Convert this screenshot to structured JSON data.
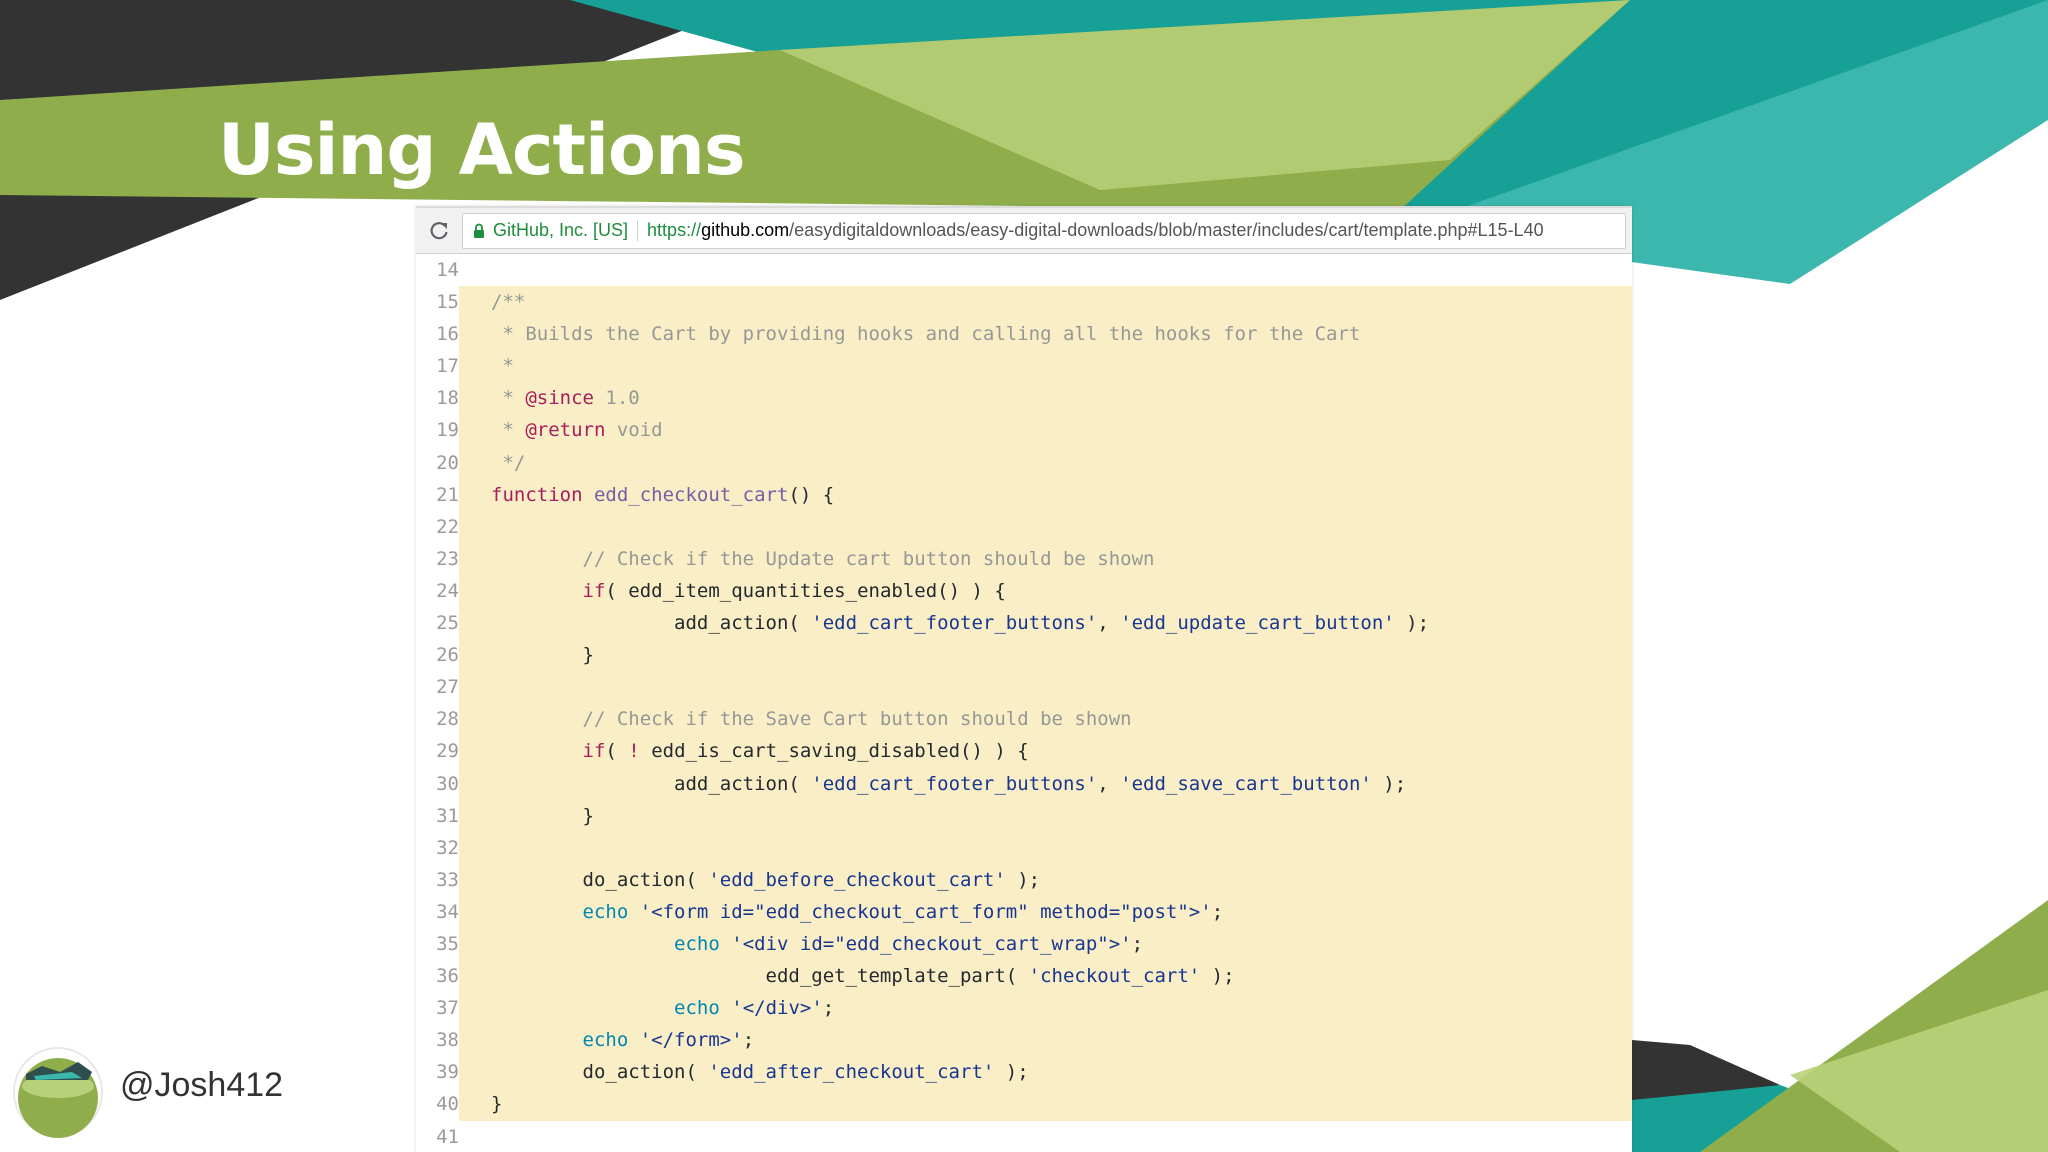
{
  "slide": {
    "title": "Using Actions",
    "handle": "@Josh412",
    "colors": {
      "dark": "#333333",
      "green": "#8fae4b",
      "light_green": "#b9d07a",
      "teal": "#17a096",
      "light_teal": "#3bb7ad"
    }
  },
  "browser": {
    "reload_icon": "reload-icon",
    "lock_icon": "lock-icon",
    "ev_label": "GitHub, Inc. [US]",
    "url_scheme": "https://",
    "url_host": "github.com",
    "url_path": "/easydigitaldownloads/easy-digital-downloads/blob/master/includes/cart/template.php#L15-L40"
  },
  "code": {
    "highlight_range": [
      15,
      40
    ],
    "lines": [
      {
        "n": "14",
        "tokens": []
      },
      {
        "n": "15",
        "tokens": [
          {
            "t": "comment",
            "v": "/**"
          }
        ]
      },
      {
        "n": "16",
        "tokens": [
          {
            "t": "comment",
            "v": " * Builds the Cart by providing hooks and calling all the hooks for the Cart"
          }
        ]
      },
      {
        "n": "17",
        "tokens": [
          {
            "t": "comment",
            "v": " *"
          }
        ]
      },
      {
        "n": "18",
        "tokens": [
          {
            "t": "comment",
            "v": " * "
          },
          {
            "t": "doctag",
            "v": "@since"
          },
          {
            "t": "comment",
            "v": " 1.0"
          }
        ]
      },
      {
        "n": "19",
        "tokens": [
          {
            "t": "comment",
            "v": " * "
          },
          {
            "t": "doctag",
            "v": "@return"
          },
          {
            "t": "comment",
            "v": " void"
          }
        ]
      },
      {
        "n": "20",
        "tokens": [
          {
            "t": "comment",
            "v": " */"
          }
        ]
      },
      {
        "n": "21",
        "tokens": [
          {
            "t": "kw",
            "v": "function"
          },
          {
            "t": "plain",
            "v": " "
          },
          {
            "t": "fn",
            "v": "edd_checkout_cart"
          },
          {
            "t": "plain",
            "v": "() {"
          }
        ]
      },
      {
        "n": "22",
        "tokens": []
      },
      {
        "n": "23",
        "tokens": [
          {
            "t": "plain",
            "v": "        "
          },
          {
            "t": "comment",
            "v": "// Check if the Update cart button should be shown"
          }
        ]
      },
      {
        "n": "24",
        "tokens": [
          {
            "t": "plain",
            "v": "        "
          },
          {
            "t": "kw",
            "v": "if"
          },
          {
            "t": "plain",
            "v": "( edd_item_quantities_enabled() ) {"
          }
        ]
      },
      {
        "n": "25",
        "tokens": [
          {
            "t": "plain",
            "v": "                add_action( "
          },
          {
            "t": "str",
            "v": "'edd_cart_footer_buttons'"
          },
          {
            "t": "plain",
            "v": ", "
          },
          {
            "t": "str",
            "v": "'edd_update_cart_button'"
          },
          {
            "t": "plain",
            "v": " );"
          }
        ]
      },
      {
        "n": "26",
        "tokens": [
          {
            "t": "plain",
            "v": "        }"
          }
        ]
      },
      {
        "n": "27",
        "tokens": []
      },
      {
        "n": "28",
        "tokens": [
          {
            "t": "plain",
            "v": "        "
          },
          {
            "t": "comment",
            "v": "// Check if the Save Cart button should be shown"
          }
        ]
      },
      {
        "n": "29",
        "tokens": [
          {
            "t": "plain",
            "v": "        "
          },
          {
            "t": "kw",
            "v": "if"
          },
          {
            "t": "plain",
            "v": "( "
          },
          {
            "t": "kw",
            "v": "!"
          },
          {
            "t": "plain",
            "v": " edd_is_cart_saving_disabled() ) {"
          }
        ]
      },
      {
        "n": "30",
        "tokens": [
          {
            "t": "plain",
            "v": "                add_action( "
          },
          {
            "t": "str",
            "v": "'edd_cart_footer_buttons'"
          },
          {
            "t": "plain",
            "v": ", "
          },
          {
            "t": "str",
            "v": "'edd_save_cart_button'"
          },
          {
            "t": "plain",
            "v": " );"
          }
        ]
      },
      {
        "n": "31",
        "tokens": [
          {
            "t": "plain",
            "v": "        }"
          }
        ]
      },
      {
        "n": "32",
        "tokens": []
      },
      {
        "n": "33",
        "tokens": [
          {
            "t": "plain",
            "v": "        do_action( "
          },
          {
            "t": "str",
            "v": "'edd_before_checkout_cart'"
          },
          {
            "t": "plain",
            "v": " );"
          }
        ]
      },
      {
        "n": "34",
        "tokens": [
          {
            "t": "plain",
            "v": "        "
          },
          {
            "t": "echo",
            "v": "echo"
          },
          {
            "t": "plain",
            "v": " "
          },
          {
            "t": "str",
            "v": "'<form id=\"edd_checkout_cart_form\" method=\"post\">'"
          },
          {
            "t": "plain",
            "v": ";"
          }
        ]
      },
      {
        "n": "35",
        "tokens": [
          {
            "t": "plain",
            "v": "                "
          },
          {
            "t": "echo",
            "v": "echo"
          },
          {
            "t": "plain",
            "v": " "
          },
          {
            "t": "str",
            "v": "'<div id=\"edd_checkout_cart_wrap\">'"
          },
          {
            "t": "plain",
            "v": ";"
          }
        ]
      },
      {
        "n": "36",
        "tokens": [
          {
            "t": "plain",
            "v": "                        edd_get_template_part( "
          },
          {
            "t": "str",
            "v": "'checkout_cart'"
          },
          {
            "t": "plain",
            "v": " );"
          }
        ]
      },
      {
        "n": "37",
        "tokens": [
          {
            "t": "plain",
            "v": "                "
          },
          {
            "t": "echo",
            "v": "echo"
          },
          {
            "t": "plain",
            "v": " "
          },
          {
            "t": "str",
            "v": "'</div>'"
          },
          {
            "t": "plain",
            "v": ";"
          }
        ]
      },
      {
        "n": "38",
        "tokens": [
          {
            "t": "plain",
            "v": "        "
          },
          {
            "t": "echo",
            "v": "echo"
          },
          {
            "t": "plain",
            "v": " "
          },
          {
            "t": "str",
            "v": "'</form>'"
          },
          {
            "t": "plain",
            "v": ";"
          }
        ]
      },
      {
        "n": "39",
        "tokens": [
          {
            "t": "plain",
            "v": "        do_action( "
          },
          {
            "t": "str",
            "v": "'edd_after_checkout_cart'"
          },
          {
            "t": "plain",
            "v": " );"
          }
        ]
      },
      {
        "n": "40",
        "tokens": [
          {
            "t": "plain",
            "v": "}"
          }
        ]
      },
      {
        "n": "41",
        "tokens": []
      }
    ]
  }
}
